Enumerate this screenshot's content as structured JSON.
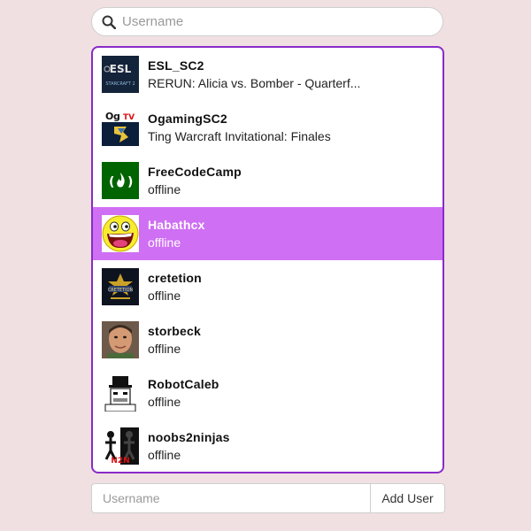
{
  "search": {
    "placeholder": "Username",
    "icon": "search-icon"
  },
  "users": [
    {
      "name": "ESL_SC2",
      "status": "RERUN: Alicia vs. Bomber - Quarterf...",
      "avatar": "esl-starcraft-avatar",
      "active": false
    },
    {
      "name": "OgamingSC2",
      "status": "Ting Warcraft Invitational: Finales",
      "avatar": "ogaming-avatar",
      "active": false
    },
    {
      "name": "FreeCodeCamp",
      "status": "offline",
      "avatar": "freecodecamp-avatar",
      "active": false
    },
    {
      "name": "Habathcx",
      "status": "offline",
      "avatar": "awesome-face-avatar",
      "active": true
    },
    {
      "name": "cretetion",
      "status": "offline",
      "avatar": "cretetion-avatar",
      "active": false
    },
    {
      "name": "storbeck",
      "status": "offline",
      "avatar": "storbeck-photo-avatar",
      "active": false
    },
    {
      "name": "RobotCaleb",
      "status": "offline",
      "avatar": "robotcaleb-avatar",
      "active": false
    },
    {
      "name": "noobs2ninjas",
      "status": "offline",
      "avatar": "noobs2ninjas-avatar",
      "active": false
    }
  ],
  "add_user": {
    "placeholder": "Username",
    "button_label": "Add User"
  },
  "colors": {
    "accent_border": "#8a2bc7",
    "active_row": "#cf6ff3",
    "background": "#f0e0e2"
  }
}
